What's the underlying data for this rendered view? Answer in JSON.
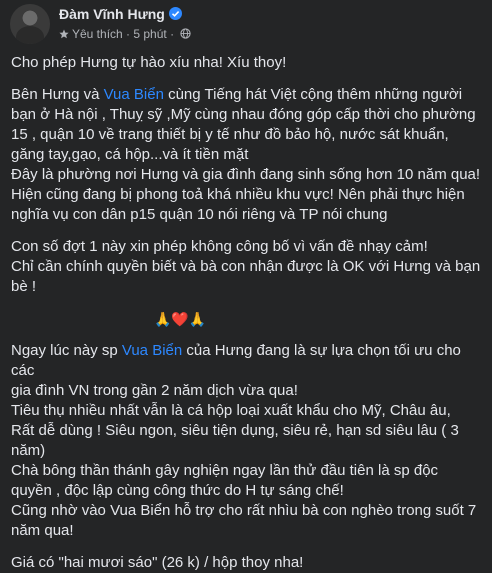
{
  "post": {
    "author": "Đàm Vĩnh Hưng",
    "meta_favorites": "Yêu thích",
    "meta_sep": " · ",
    "meta_time": "5 phút",
    "meta_sep2": " · ",
    "colors": {
      "background": "#242526",
      "text": "#e4e6eb",
      "link": "#2d88ff",
      "muted": "#b0b3b8"
    },
    "icons": [
      "verified-badge-icon",
      "star-icon",
      "globe-icon",
      "more-options-icon"
    ],
    "lines": {
      "l1": "Cho phép Hưng tự hào xíu nha!  Xíu thoy!",
      "l2a": "Bên Hưng và ",
      "l2link": "Vua Biển",
      "l2b": " cùng Tiếng hát Việt cộng thêm những người",
      "l3": "bạn ở Hà nội , Thuỵ sỹ ,Mỹ cùng nhau đóng góp cấp thời cho phường",
      "l4": "15 , quận 10 về trang thiết bị y tế như đồ bảo hộ, nước sát khuẩn,",
      "l5": "găng tay,gạo, cá hộp...và ít tiền mặt",
      "l6": "Đây là phường nơi Hưng và gia đình đang sinh sống hơn 10 năm qua!",
      "l7": "Hiện cũng đang bị phong toả khá nhiều khu vực! Nên phải thực hiện",
      "l8": "nghĩa vụ con dân p15 quận 10 nói riêng và TP nói chung",
      "l9": "Con số đợt 1 này xin phép không công bố vì vấn đề nhạy cảm!",
      "l10": "Chỉ cần chính quyền biết và bà con nhận được là OK với  Hưng và bạn",
      "l11": "bè !",
      "emoji": "🙏❤️🙏",
      "l12a": "Ngay lúc này sp ",
      "l12link": "Vua Biển",
      "l12b": " của Hưng đang là sự lựa chọn tối ưu cho các",
      "l13": "gia đình VN trong gần 2 năm dịch vừa qua!",
      "l14": "Tiêu thụ nhiều nhất vẫn là cá hộp loại xuất khẩu cho Mỹ, Châu âu,",
      "l15": "Rất dễ dùng ! Siêu ngon, siêu tiện dụng, siêu rẻ, hạn sd siêu lâu ( 3",
      "l16": "năm)",
      "l17": "Chà bông thần thánh gây nghiện ngay lần thử đầu tiên là sp độc",
      "l18": "quyền , độc lập cùng công thức do H tự sáng chế!",
      "l19": "Cũng nhờ vào Vua Biển hỗ trợ cho rất nhìu bà con nghèo trong suốt 7",
      "l20": "năm qua!",
      "l21": "Giá có \"hai mươi sáo\" (26 k) / hộp thoy nha!"
    }
  }
}
